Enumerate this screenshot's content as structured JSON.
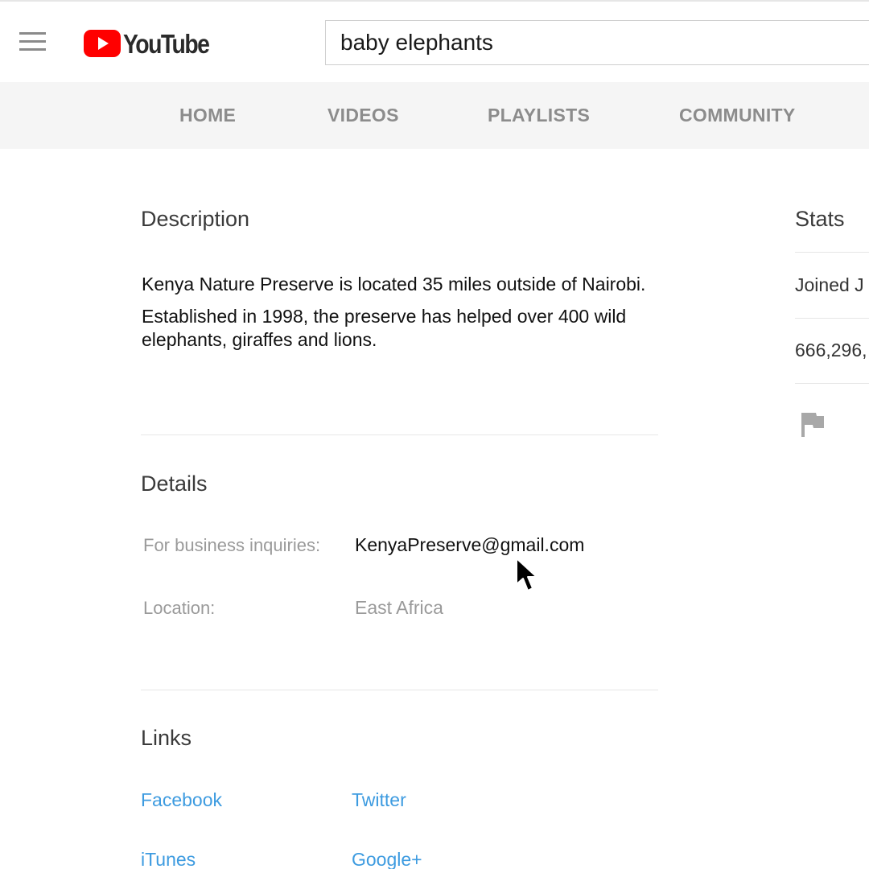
{
  "header": {
    "menu_icon": "hamburger-menu-icon",
    "logo_text": "YouTube",
    "logo_icon": "youtube-play-icon",
    "brand_color": "#ff0000",
    "search_value": "baby elephants"
  },
  "tabs": [
    {
      "label": "HOME"
    },
    {
      "label": "VIDEOS"
    },
    {
      "label": "PLAYLISTS"
    },
    {
      "label": "COMMUNITY"
    }
  ],
  "description": {
    "title": "Description",
    "lines": [
      "Kenya Nature Preserve is located 35 miles outside of Nairobi.",
      "Established in 1998, the preserve has helped over 400 wild",
      "elephants, giraffes and lions."
    ]
  },
  "details": {
    "title": "Details",
    "business_label": "For business inquiries:",
    "business_value": "KenyaPreserve@gmail.com",
    "location_label": "Location:",
    "location_value": "East Africa"
  },
  "links": {
    "title": "Links",
    "items": [
      "Facebook",
      "Twitter",
      "iTunes",
      "Google+"
    ],
    "link_color": "#3d9be0"
  },
  "stats": {
    "title": "Stats",
    "joined": "Joined J",
    "views": "666,296,",
    "flag_icon": "flag-icon"
  }
}
